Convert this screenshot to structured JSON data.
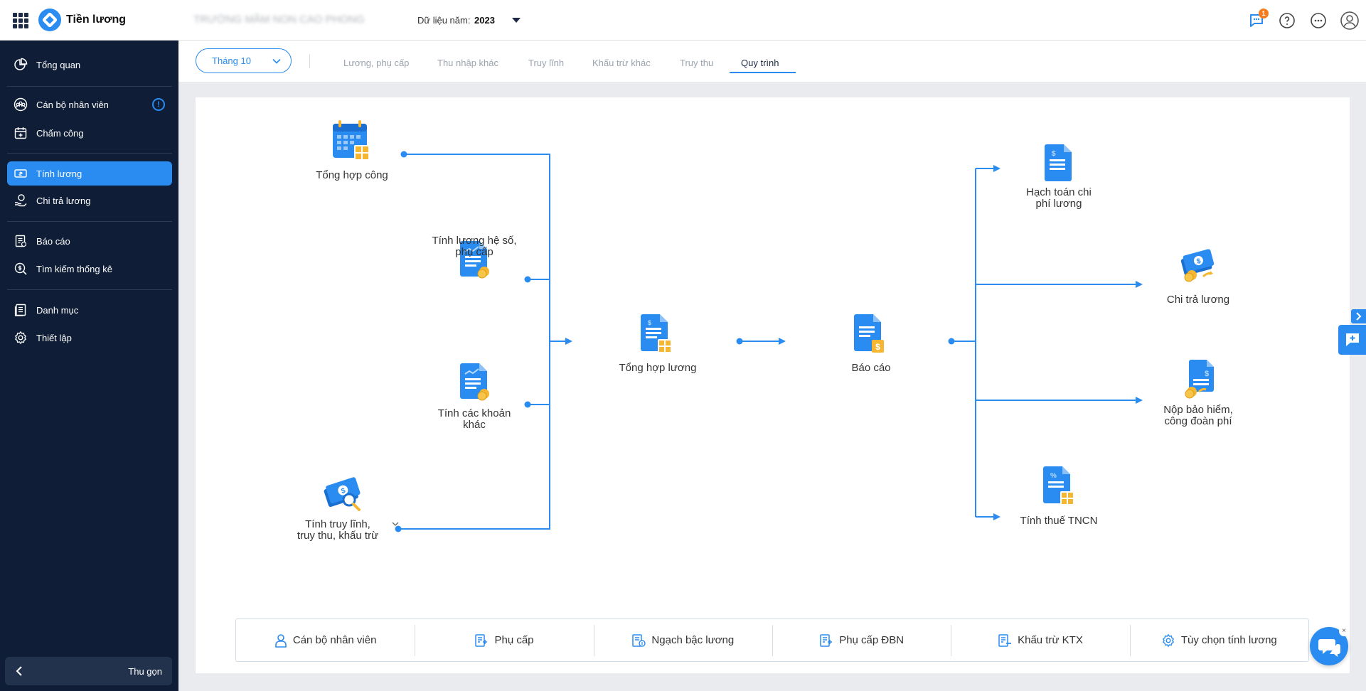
{
  "header": {
    "app_title": "Tiền lương",
    "org_name": "TRƯỜNG MẦM NON CAO PHONG",
    "year_label": "Dữ liệu năm:",
    "year_value": "2023",
    "notification_count": "1",
    "icons": [
      "apps-grid-icon",
      "chat-notification-icon",
      "help-icon",
      "more-icon",
      "user-avatar-icon"
    ]
  },
  "sidebar": {
    "items": [
      {
        "label": "Tổng quan",
        "icon": "pie-chart-icon"
      },
      {
        "label": "Cán bộ nhân viên",
        "icon": "staff-icon"
      },
      {
        "label": "Chấm công",
        "icon": "calendar-icon"
      },
      {
        "label": "Tính lương",
        "icon": "payroll-icon"
      },
      {
        "label": "Chi trả lương",
        "icon": "payment-icon"
      },
      {
        "label": "Báo cáo",
        "icon": "report-icon"
      },
      {
        "label": "Tìm kiếm thống kê",
        "icon": "search-dollar-icon"
      },
      {
        "label": "Danh mục",
        "icon": "catalog-icon"
      },
      {
        "label": "Thiết lập",
        "icon": "settings-icon"
      }
    ],
    "active": "Tính lương",
    "collapse_label": "Thu gọn"
  },
  "tabbar": {
    "month_select": "Tháng 10",
    "tabs": [
      "Lương, phụ cấp",
      "Thu nhập khác",
      "Truy lĩnh",
      "Khấu trừ khác",
      "Truy thu",
      "Quy trình"
    ],
    "active_tab": "Quy trình"
  },
  "flow": {
    "tong_hop_cong": "Tổng hợp công",
    "tinh_luong_he_so": [
      "Tính lương hệ số,",
      "phụ cấp"
    ],
    "tinh_cac_khoan_khac": [
      "Tính các khoản",
      "khác"
    ],
    "tinh_truy_linh": [
      "Tính truy lĩnh,",
      "truy thu, khấu trừ"
    ],
    "tong_hop_luong": "Tổng hợp lương",
    "bao_cao": "Báo cáo",
    "hach_toan": [
      "Hạch toán chi",
      "phí lương"
    ],
    "chi_tra_luong": "Chi trả lương",
    "nop_bao_hiem": [
      "Nộp bảo hiểm,",
      "công đoàn phí"
    ],
    "tinh_thue": "Tính thuế TNCN"
  },
  "shortcuts": [
    {
      "label": "Cán bộ nhân viên",
      "icon": "user-icon"
    },
    {
      "label": "Phụ cấp",
      "icon": "allowance-icon"
    },
    {
      "label": "Ngạch bậc lương",
      "icon": "salary-grade-icon"
    },
    {
      "label": "Phụ cấp ĐBN",
      "icon": "allowance-dbn-icon"
    },
    {
      "label": "Khấu trừ KTX",
      "icon": "deduction-icon"
    },
    {
      "label": "Tùy chọn tính lương",
      "icon": "gear-icon"
    }
  ],
  "colors": {
    "sidebar_bg": "#0f1e36",
    "accent": "#2a8cf0",
    "badge": "#f57c1f"
  }
}
